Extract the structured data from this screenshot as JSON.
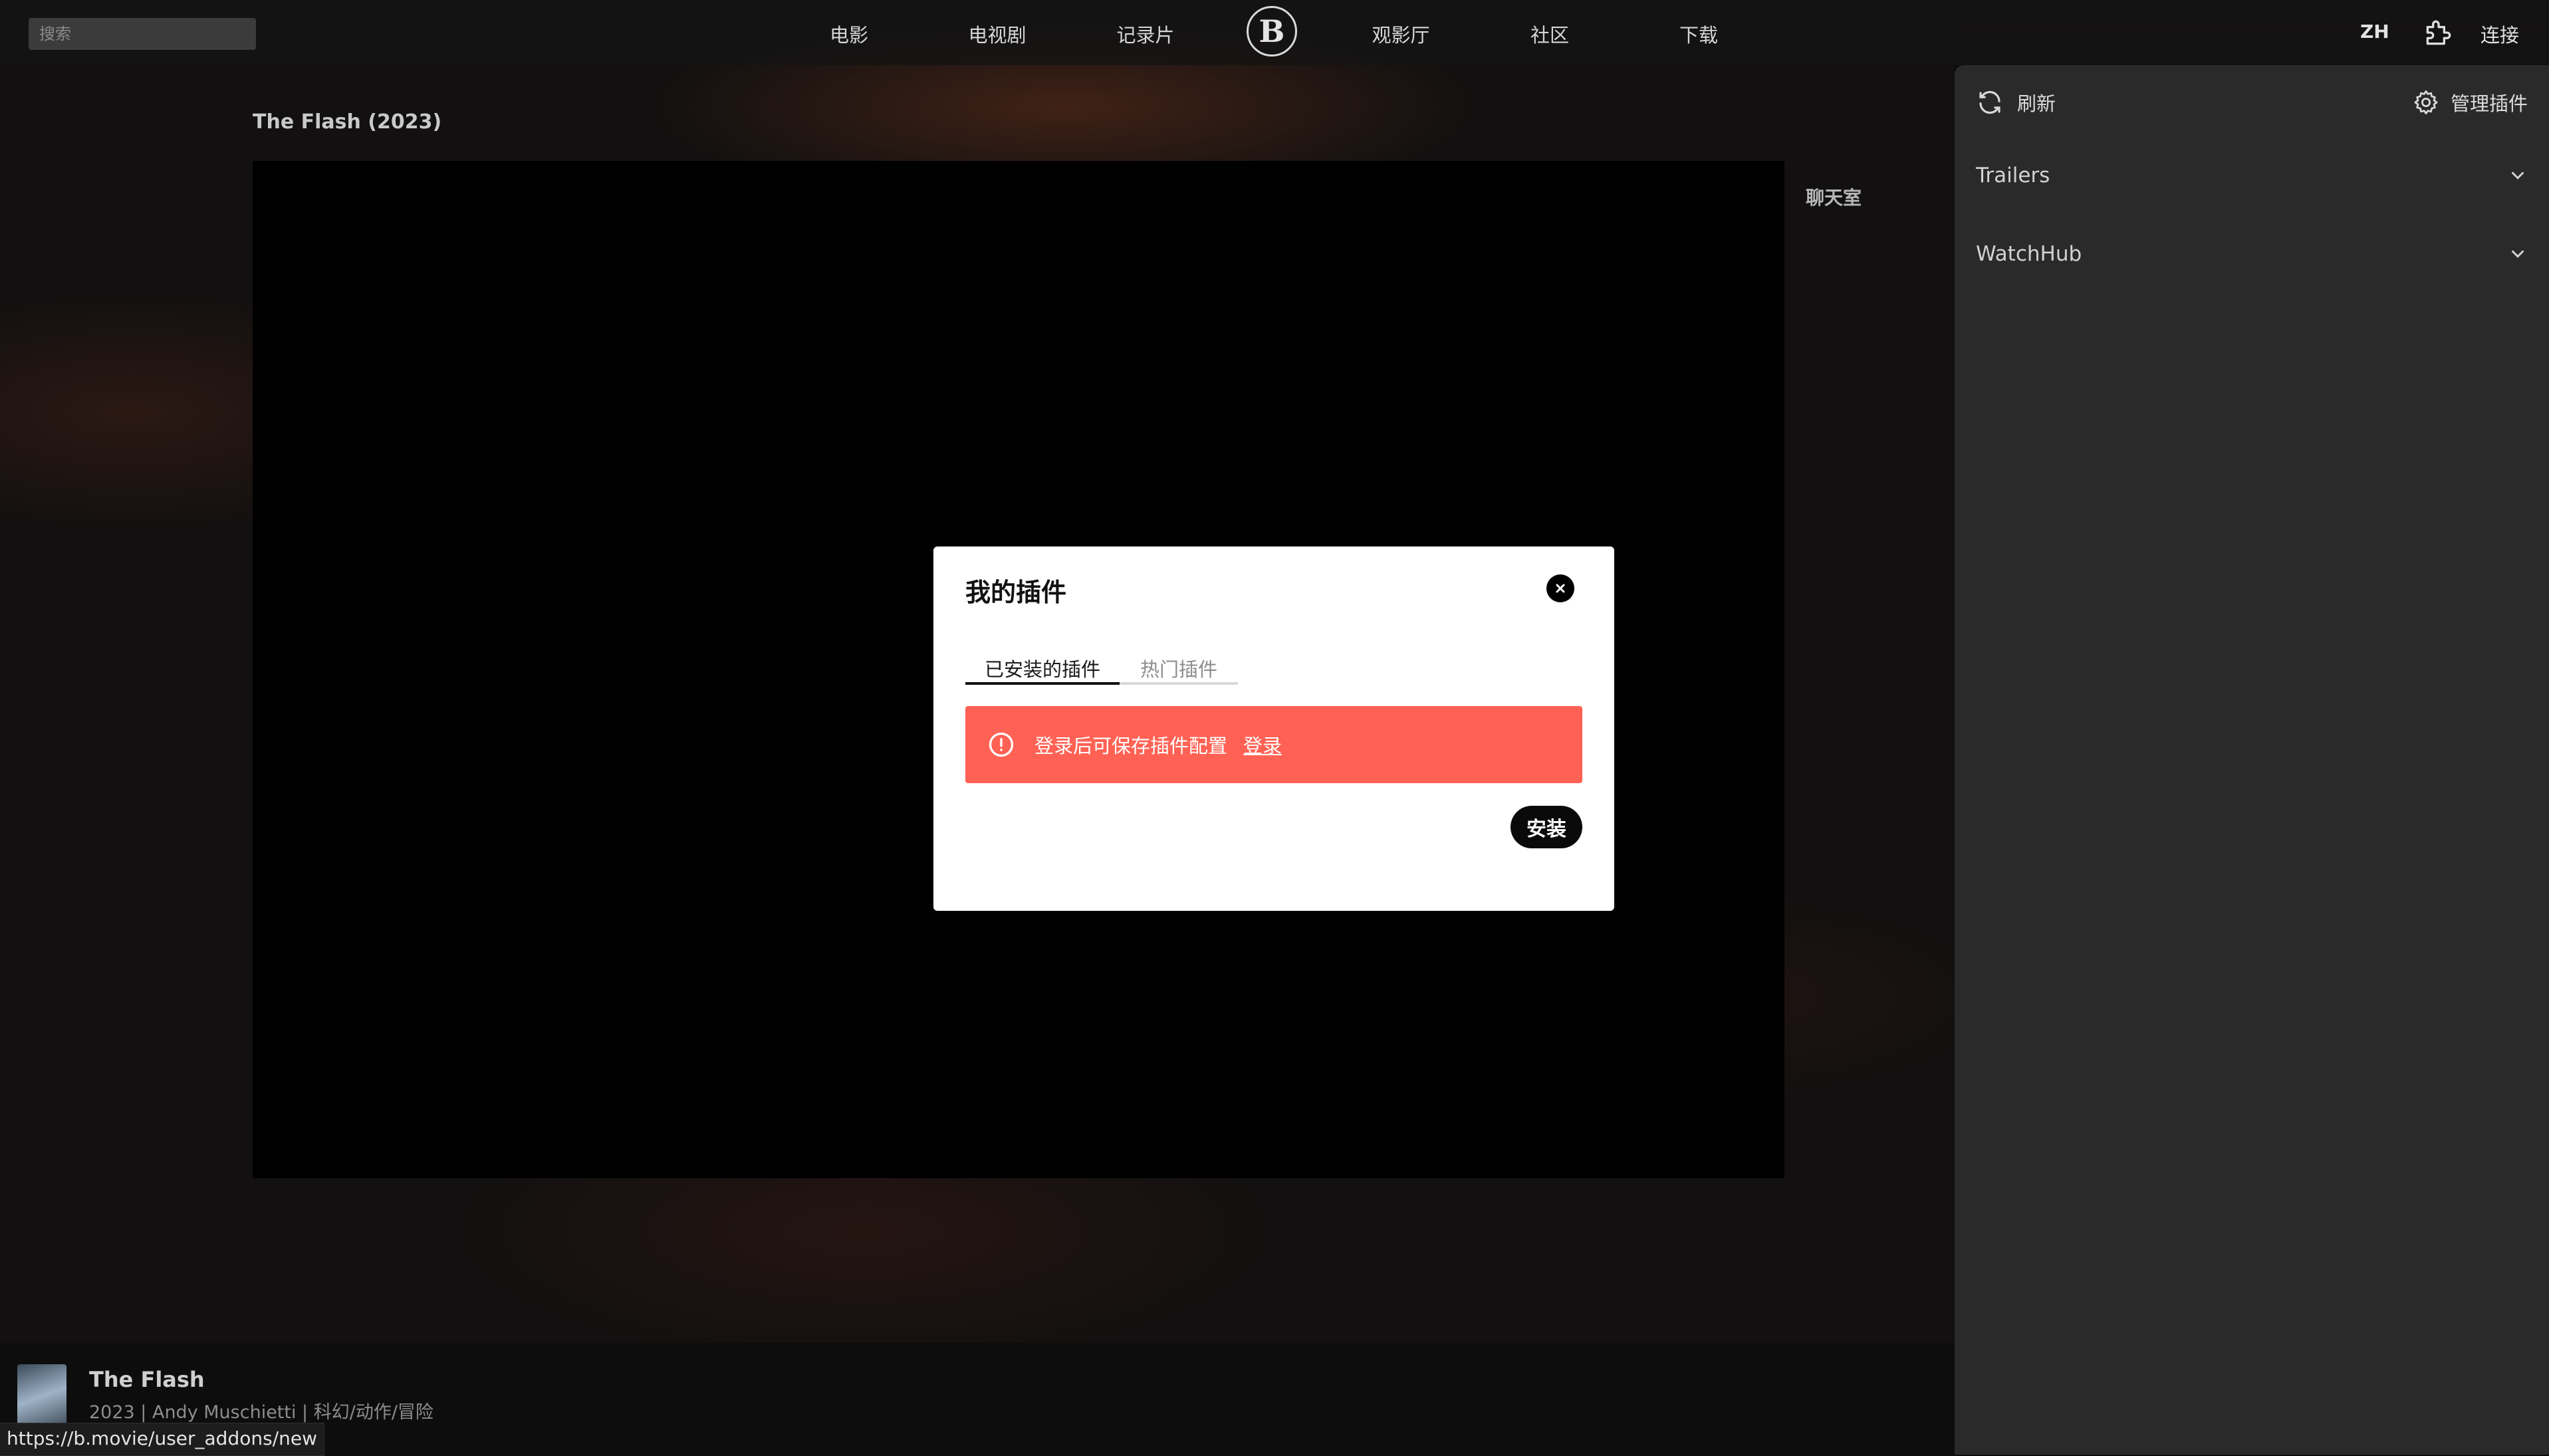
{
  "search": {
    "placeholder": "搜索"
  },
  "nav": {
    "movies": "电影",
    "tv": "电视剧",
    "documentary": "记录片",
    "logo_letter": "B",
    "theater": "观影厅",
    "community": "社区",
    "download": "下载",
    "lang": "ZH",
    "connect": "连接"
  },
  "main": {
    "title": "The Flash (2023)",
    "chatroom": "聊天室"
  },
  "bottom": {
    "title": "The Flash",
    "meta": "2023 | Andy Muschietti | 科幻/动作/冒险",
    "status_url": "https://b.movie/user_addons/new"
  },
  "sidebar": {
    "refresh": "刷新",
    "manage": "管理插件",
    "items": [
      {
        "label": "Trailers"
      },
      {
        "label": "WatchHub"
      }
    ]
  },
  "modal": {
    "title": "我的插件",
    "tabs": [
      {
        "label": "已安装的插件",
        "active": true
      },
      {
        "label": "热门插件",
        "active": false
      }
    ],
    "alert_text": "登录后可保存插件配置",
    "alert_link": "登录",
    "install": "安装"
  },
  "colors": {
    "alert": "#ff6254",
    "panel": "#2a2a2a",
    "player": "#000000"
  },
  "icons": [
    "puzzle-icon",
    "refresh-icon",
    "gear-icon",
    "chevron-down-icon",
    "close-icon",
    "alert-circle-icon"
  ]
}
